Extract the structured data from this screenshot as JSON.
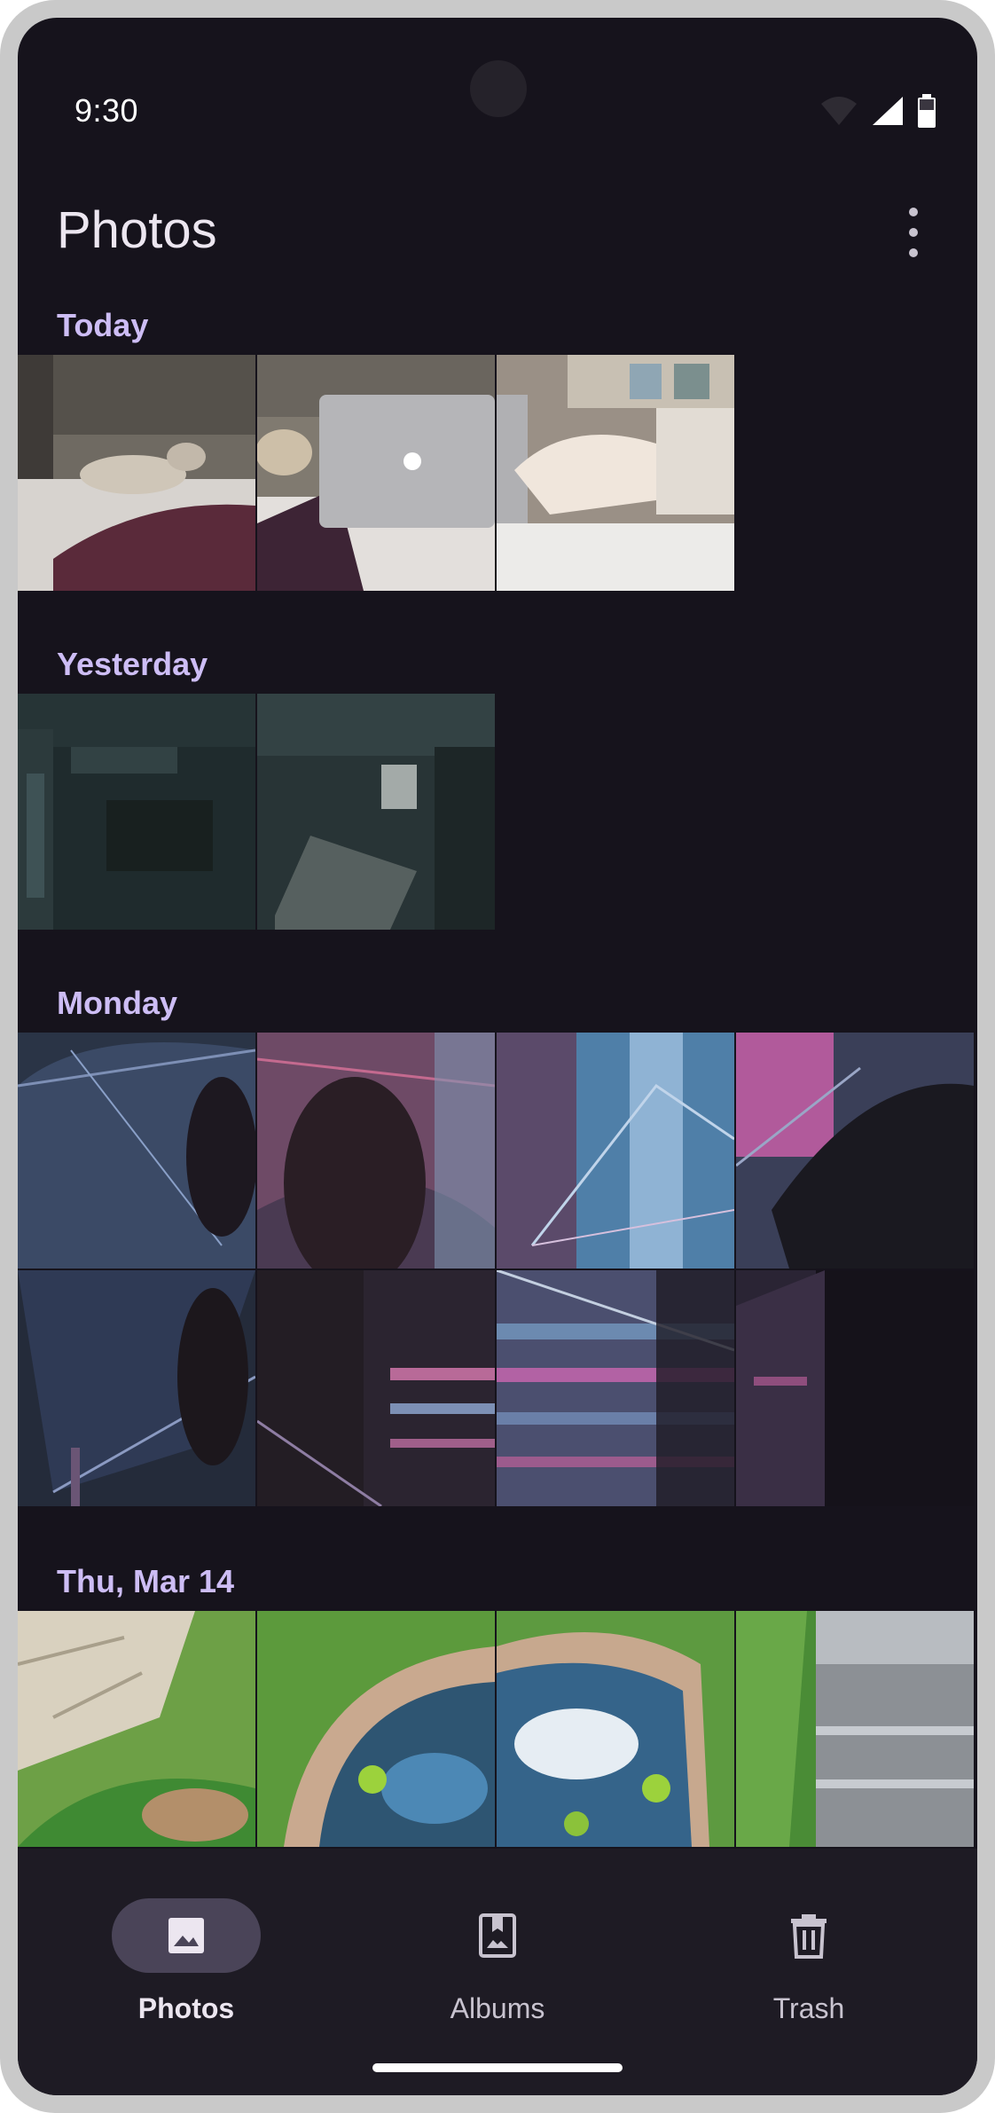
{
  "status_bar": {
    "time": "9:30"
  },
  "app_bar": {
    "title": "Photos"
  },
  "sections": [
    {
      "label": "Today",
      "photo_count": 3
    },
    {
      "label": "Yesterday",
      "photo_count": 2
    },
    {
      "label": "Monday",
      "photo_count": 8
    },
    {
      "label": "Thu, Mar 14",
      "photo_count": 4
    }
  ],
  "bottom_nav": {
    "items": [
      {
        "label": "Photos",
        "icon": "image-icon",
        "selected": true
      },
      {
        "label": "Albums",
        "icon": "album-icon",
        "selected": false
      },
      {
        "label": "Trash",
        "icon": "trash-icon",
        "selected": false
      }
    ]
  },
  "colors": {
    "background": "#16131c",
    "section_header": "#cdbdf5",
    "nav_indicator": "#4a4458",
    "nav_background": "#1e1b24"
  }
}
